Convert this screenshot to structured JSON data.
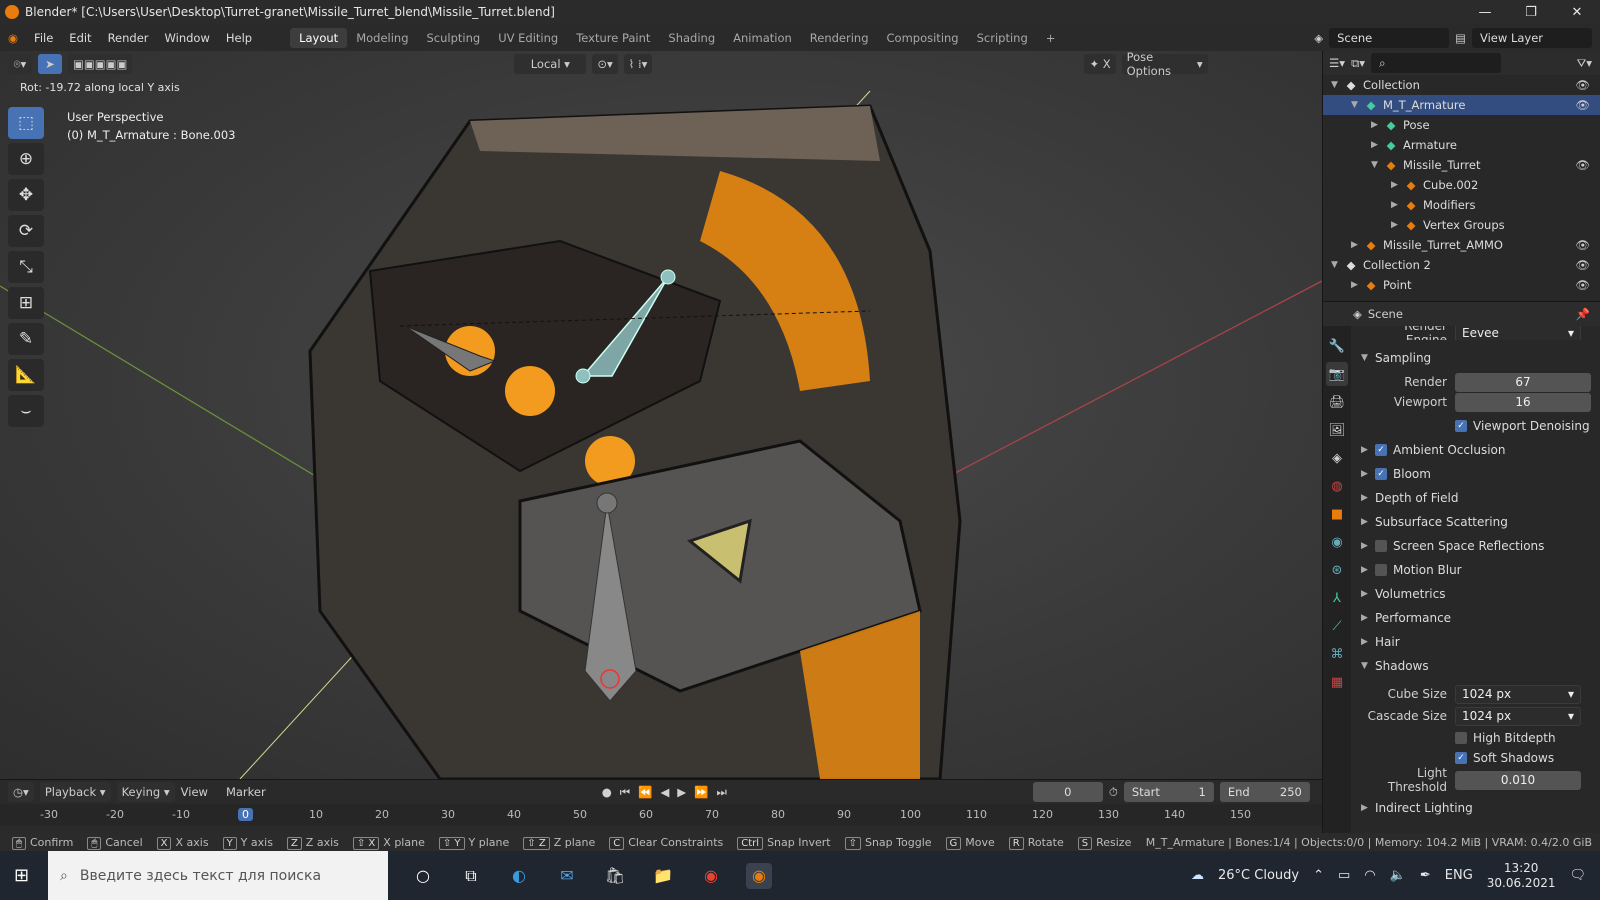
{
  "window": {
    "title": "Blender* [C:\\Users\\User\\Desktop\\Turret-granet\\Missile_Turret_blend\\Missile_Turret.blend]"
  },
  "menu": [
    "File",
    "Edit",
    "Render",
    "Window",
    "Help"
  ],
  "workspaces": [
    "Layout",
    "Modeling",
    "Sculpting",
    "UV Editing",
    "Texture Paint",
    "Shading",
    "Animation",
    "Rendering",
    "Compositing",
    "Scripting"
  ],
  "scene": "Scene",
  "view_layer": "View Layer",
  "viewport": {
    "orientation": "Local",
    "pose_options": "Pose Options",
    "hud": "Rot: -19.72 along local Y axis",
    "perspective": "User Perspective",
    "selection": "(0) M_T_Armature : Bone.003"
  },
  "outliner": {
    "rows": [
      {
        "name": "Collection",
        "level": 0,
        "icon": "collection-icon",
        "expanded": true,
        "selected": false,
        "eye": true
      },
      {
        "name": "M_T_Armature",
        "level": 1,
        "icon": "armature-icon",
        "expanded": true,
        "selected": true,
        "eye": true
      },
      {
        "name": "Pose",
        "level": 2,
        "icon": "pose-icon",
        "expanded": false,
        "selected": false,
        "eye": false
      },
      {
        "name": "Armature",
        "level": 2,
        "icon": "armature-data-icon",
        "expanded": false,
        "selected": false,
        "eye": false
      },
      {
        "name": "Missile_Turret",
        "level": 2,
        "icon": "mesh-object-icon",
        "expanded": true,
        "selected": false,
        "eye": true
      },
      {
        "name": "Cube.002",
        "level": 3,
        "icon": "mesh-data-icon",
        "expanded": false,
        "selected": false,
        "eye": false
      },
      {
        "name": "Modifiers",
        "level": 3,
        "icon": "wrench-icon",
        "expanded": false,
        "selected": false,
        "eye": false
      },
      {
        "name": "Vertex Groups",
        "level": 3,
        "icon": "vertex-groups-icon",
        "expanded": false,
        "selected": false,
        "eye": false
      },
      {
        "name": "Missile_Turret_AMMO",
        "level": 1,
        "icon": "mesh-object-icon",
        "expanded": false,
        "selected": false,
        "eye": true
      },
      {
        "name": "Collection 2",
        "level": 0,
        "icon": "collection-icon",
        "expanded": true,
        "selected": false,
        "eye": true
      },
      {
        "name": "Point",
        "level": 1,
        "icon": "light-icon",
        "expanded": false,
        "selected": false,
        "eye": true
      }
    ]
  },
  "properties": {
    "header": "Scene",
    "render_engine_label": "Render Engine",
    "render_engine": "Eevee",
    "sampling": {
      "title": "Sampling",
      "render_label": "Render",
      "render": "67",
      "viewport_label": "Viewport",
      "viewport": "16",
      "denoise": "Viewport Denoising"
    },
    "panels": [
      {
        "label": "Ambient Occlusion",
        "checkbox": true,
        "checked": true
      },
      {
        "label": "Bloom",
        "checkbox": true,
        "checked": true
      },
      {
        "label": "Depth of Field",
        "checkbox": false,
        "checked": false
      },
      {
        "label": "Subsurface Scattering",
        "checkbox": false,
        "checked": false
      },
      {
        "label": "Screen Space Reflections",
        "checkbox": true,
        "checked": false
      },
      {
        "label": "Motion Blur",
        "checkbox": true,
        "checked": false
      },
      {
        "label": "Volumetrics",
        "checkbox": false,
        "checked": false
      },
      {
        "label": "Performance",
        "checkbox": false,
        "checked": false
      },
      {
        "label": "Hair",
        "checkbox": false,
        "checked": false
      }
    ],
    "shadows": {
      "title": "Shadows",
      "cube_size_label": "Cube Size",
      "cube_size": "1024 px",
      "cascade_size_label": "Cascade Size",
      "cascade_size": "1024 px",
      "high_bitdepth": "High Bitdepth",
      "soft_shadows": "Soft Shadows",
      "light_threshold_label": "Light Threshold",
      "light_threshold": "0.010"
    },
    "indirect": "Indirect Lighting"
  },
  "timeline": {
    "menus": [
      "Playback",
      "Keying",
      "View",
      "Marker"
    ],
    "current_frame": "0",
    "start_label": "Start",
    "start": "1",
    "end_label": "End",
    "end": "250",
    "ticks": [
      "-30",
      "-20",
      "-10",
      "0",
      "10",
      "20",
      "30",
      "40",
      "50",
      "60",
      "70",
      "80",
      "90",
      "100",
      "110",
      "120",
      "130",
      "140",
      "150"
    ]
  },
  "statusbar": {
    "items": [
      {
        "key": "",
        "label": "Confirm"
      },
      {
        "key": "",
        "label": "Cancel"
      },
      {
        "key": "X",
        "label": "X axis"
      },
      {
        "key": "Y",
        "label": "Y axis"
      },
      {
        "key": "Z",
        "label": "Z axis"
      },
      {
        "key": "⇧ X",
        "label": "X plane"
      },
      {
        "key": "⇧ Y",
        "label": "Y plane"
      },
      {
        "key": "⇧ Z",
        "label": "Z plane"
      },
      {
        "key": "C",
        "label": "Clear Constraints"
      },
      {
        "key": "Ctrl",
        "label": "Snap Invert"
      },
      {
        "key": "⇧",
        "label": "Snap Toggle"
      },
      {
        "key": "G",
        "label": "Move"
      },
      {
        "key": "R",
        "label": "Rotate"
      },
      {
        "key": "S",
        "label": "Resize"
      }
    ],
    "stats": "M_T_Armature | Bones:1/4 | Objects:0/0 | Memory: 104.2 MiB | VRAM: 0.4/2.0 GiB"
  },
  "taskbar": {
    "search_placeholder": "Введите здесь текст для поиска",
    "weather": "26°C  Cloudy",
    "lang": "ENG",
    "time": "13:20",
    "date": "30.06.2021"
  },
  "colors": {
    "accent": "#4772b3",
    "blender_orange": "#e87d0d",
    "glow": "#ff9a1a"
  }
}
